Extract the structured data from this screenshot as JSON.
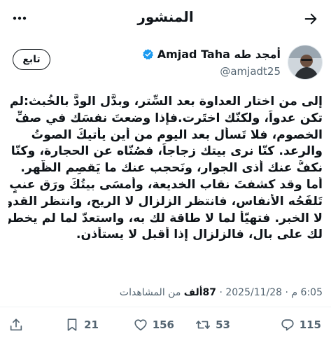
{
  "header": {
    "title": "المنشور"
  },
  "author": {
    "display_name": "أمجد طه Amjad Taha",
    "handle": "@amjadt25",
    "verified": true,
    "verified_color": "#1d9bf0"
  },
  "follow_label": "تابع",
  "post": {
    "lines": [
      "إلى من اختار العداوة بعد السِّتر، وبدَّل الودَّ بالخُبث:لم",
      "تكن عدواً، ولكنّك اختَرت.فإذا وضعتَ نفسَك في صفِّ",
      "الخصوم، فلا تَسأل بعد اليوم من أين يأتيكَ الصوتُ",
      "والرعد. كنّا نرى بيتك زجاجاً، فصُنّاه عن الحجارة، وكنّا",
      "نكفُّ عنك أذى الجوار، ونَحجب عنك ما يَقصِم الظَّهر.",
      "أما وقد كشفتَ نقاب الخديعة، وأمسَى بيتُكَ ورَق عنبٍ",
      "تَلفَحُه الأنفاس، فانتظر الزلزال لا الريح، وانتظر القدوم",
      "لا الخبر. فتهيّأ لما لا طاقة لك به، واستعدّ لما لم يخطر",
      "لك على بال، فالزلزال إذا أقبل لا يستأذن."
    ]
  },
  "meta": {
    "time": "6:05 م",
    "separator": "·",
    "date": "2025/11/28",
    "views_count": "87ألف",
    "views_label": "من المشاهدات"
  },
  "actions": {
    "replies": "115",
    "reposts": "53",
    "likes": "156",
    "bookmarks": "21"
  },
  "icons": {
    "back": "arrow-right-icon",
    "more": "more-dots-icon",
    "reply": "reply-icon",
    "repost": "repost-icon",
    "like": "heart-icon",
    "bookmark": "bookmark-icon",
    "share": "share-icon"
  }
}
